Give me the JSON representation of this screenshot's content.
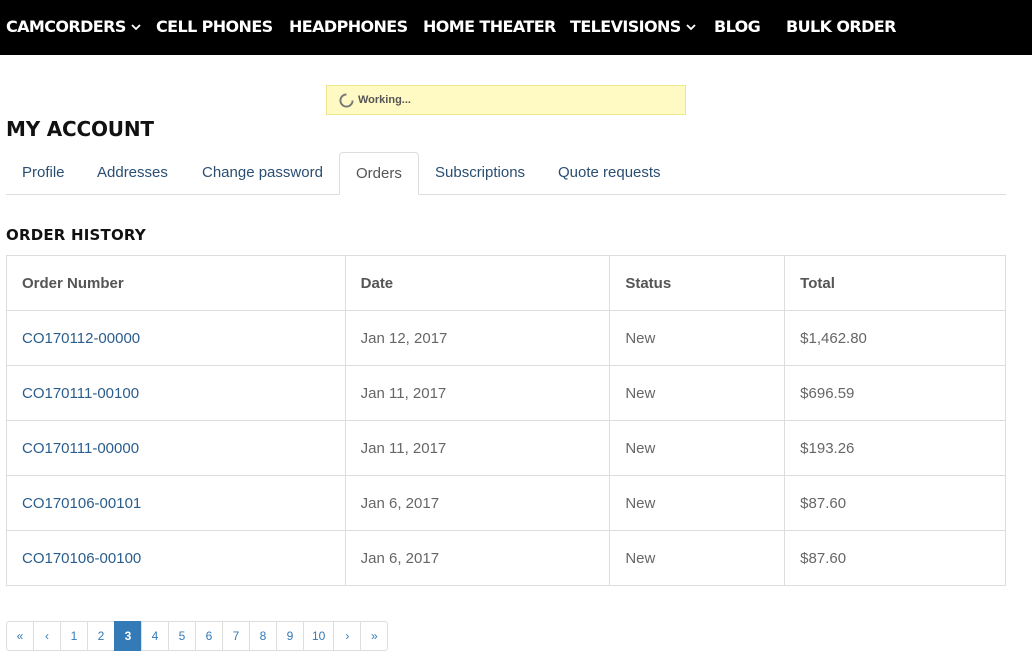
{
  "nav": {
    "items": [
      {
        "label": "CAMCORDERS",
        "has_dropdown": true
      },
      {
        "label": "CELL PHONES",
        "has_dropdown": false
      },
      {
        "label": "HEADPHONES",
        "has_dropdown": false
      },
      {
        "label": "HOME THEATER",
        "has_dropdown": false
      },
      {
        "label": "TELEVISIONS",
        "has_dropdown": true
      },
      {
        "label": "BLOG",
        "has_dropdown": false
      },
      {
        "label": "BULK ORDER",
        "has_dropdown": false
      }
    ]
  },
  "status": {
    "text": "Working...",
    "icon": "spinner-icon"
  },
  "page_title": "MY ACCOUNT",
  "tabs": [
    {
      "label": "Profile",
      "active": false
    },
    {
      "label": "Addresses",
      "active": false
    },
    {
      "label": "Change password",
      "active": false
    },
    {
      "label": "Orders",
      "active": true
    },
    {
      "label": "Subscriptions",
      "active": false
    },
    {
      "label": "Quote requests",
      "active": false
    }
  ],
  "section_title": "ORDER HISTORY",
  "table": {
    "headers": [
      "Order Number",
      "Date",
      "Status",
      "Total"
    ],
    "rows": [
      [
        "CO170112-00000",
        "Jan 12, 2017",
        "New",
        "$1,462.80"
      ],
      [
        "CO170111-00100",
        "Jan 11, 2017",
        "New",
        "$696.59"
      ],
      [
        "CO170111-00000",
        "Jan 11, 2017",
        "New",
        "$193.26"
      ],
      [
        "CO170106-00101",
        "Jan 6, 2017",
        "New",
        "$87.60"
      ],
      [
        "CO170106-00100",
        "Jan 6, 2017",
        "New",
        "$87.60"
      ]
    ]
  },
  "pagination": {
    "first": "«",
    "prev": "‹",
    "pages": [
      "1",
      "2",
      "3",
      "4",
      "5",
      "6",
      "7",
      "8",
      "9",
      "10"
    ],
    "current": "3",
    "next": "›",
    "last": "»"
  },
  "colors": {
    "nav_bg": "#000000",
    "link": "#337ab7",
    "working_bg": "#fff9c4"
  }
}
